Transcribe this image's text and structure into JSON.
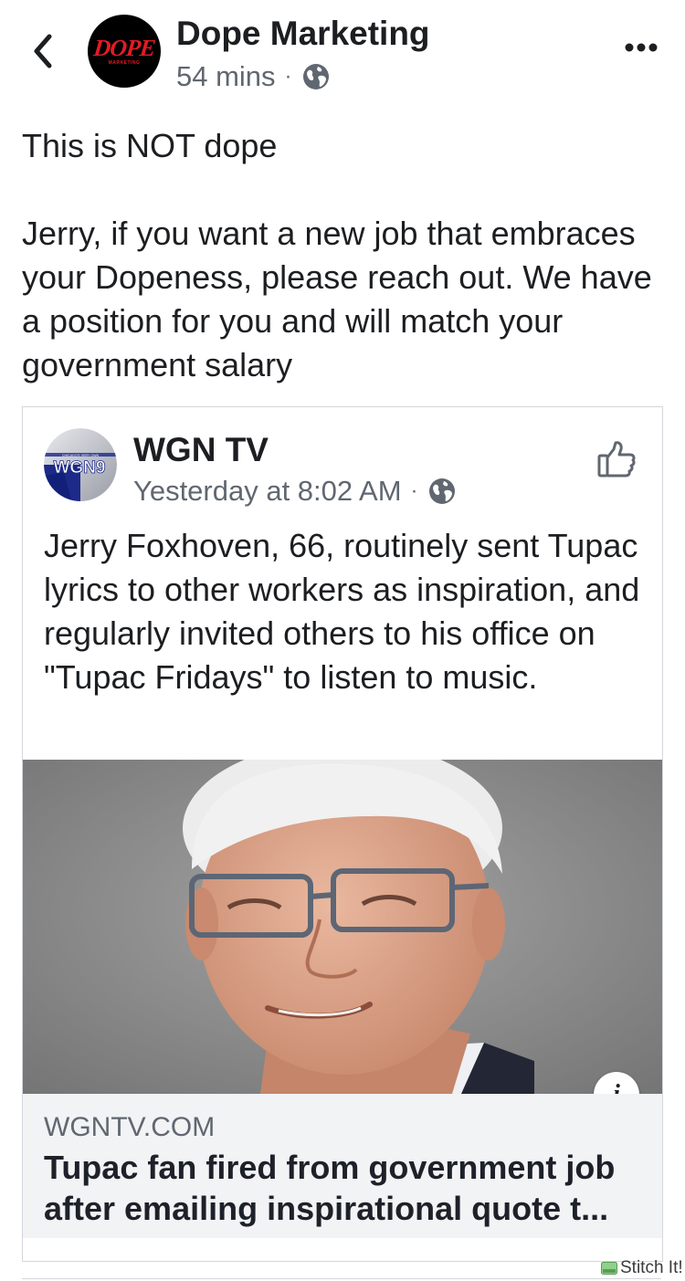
{
  "header": {
    "page_name": "Dope Marketing",
    "time": "54 mins",
    "separator": "·",
    "avatar_text": "DOPE",
    "avatar_subtext": "MARKETING"
  },
  "post": {
    "line1": "This is NOT dope",
    "line2": "Jerry, if you want a new job that embraces your Dopeness, please reach out. We have a position for you and will match your government salary"
  },
  "shared": {
    "page_name": "WGN TV",
    "time": "Yesterday at 8:02 AM",
    "separator": "·",
    "avatar_text": "WGN9",
    "avatar_tagline": "CHICAGO'S VERY OWN",
    "text": "Jerry Foxhoven, 66, routinely sent Tupac lyrics to other workers as inspiration, and regularly invited others to his office on \"Tupac Fridays\" to listen to music.",
    "info_label": "i",
    "link": {
      "domain": "WGNTV.COM",
      "title": "Tupac fan fired from government job after emailing inspirational quote t..."
    }
  },
  "watermark": "Stitch It!",
  "colors": {
    "text": "#1c1e21",
    "meta": "#606770",
    "dope_red": "#e31b23",
    "link_bg": "#f2f3f5",
    "border": "#d3d6db"
  }
}
